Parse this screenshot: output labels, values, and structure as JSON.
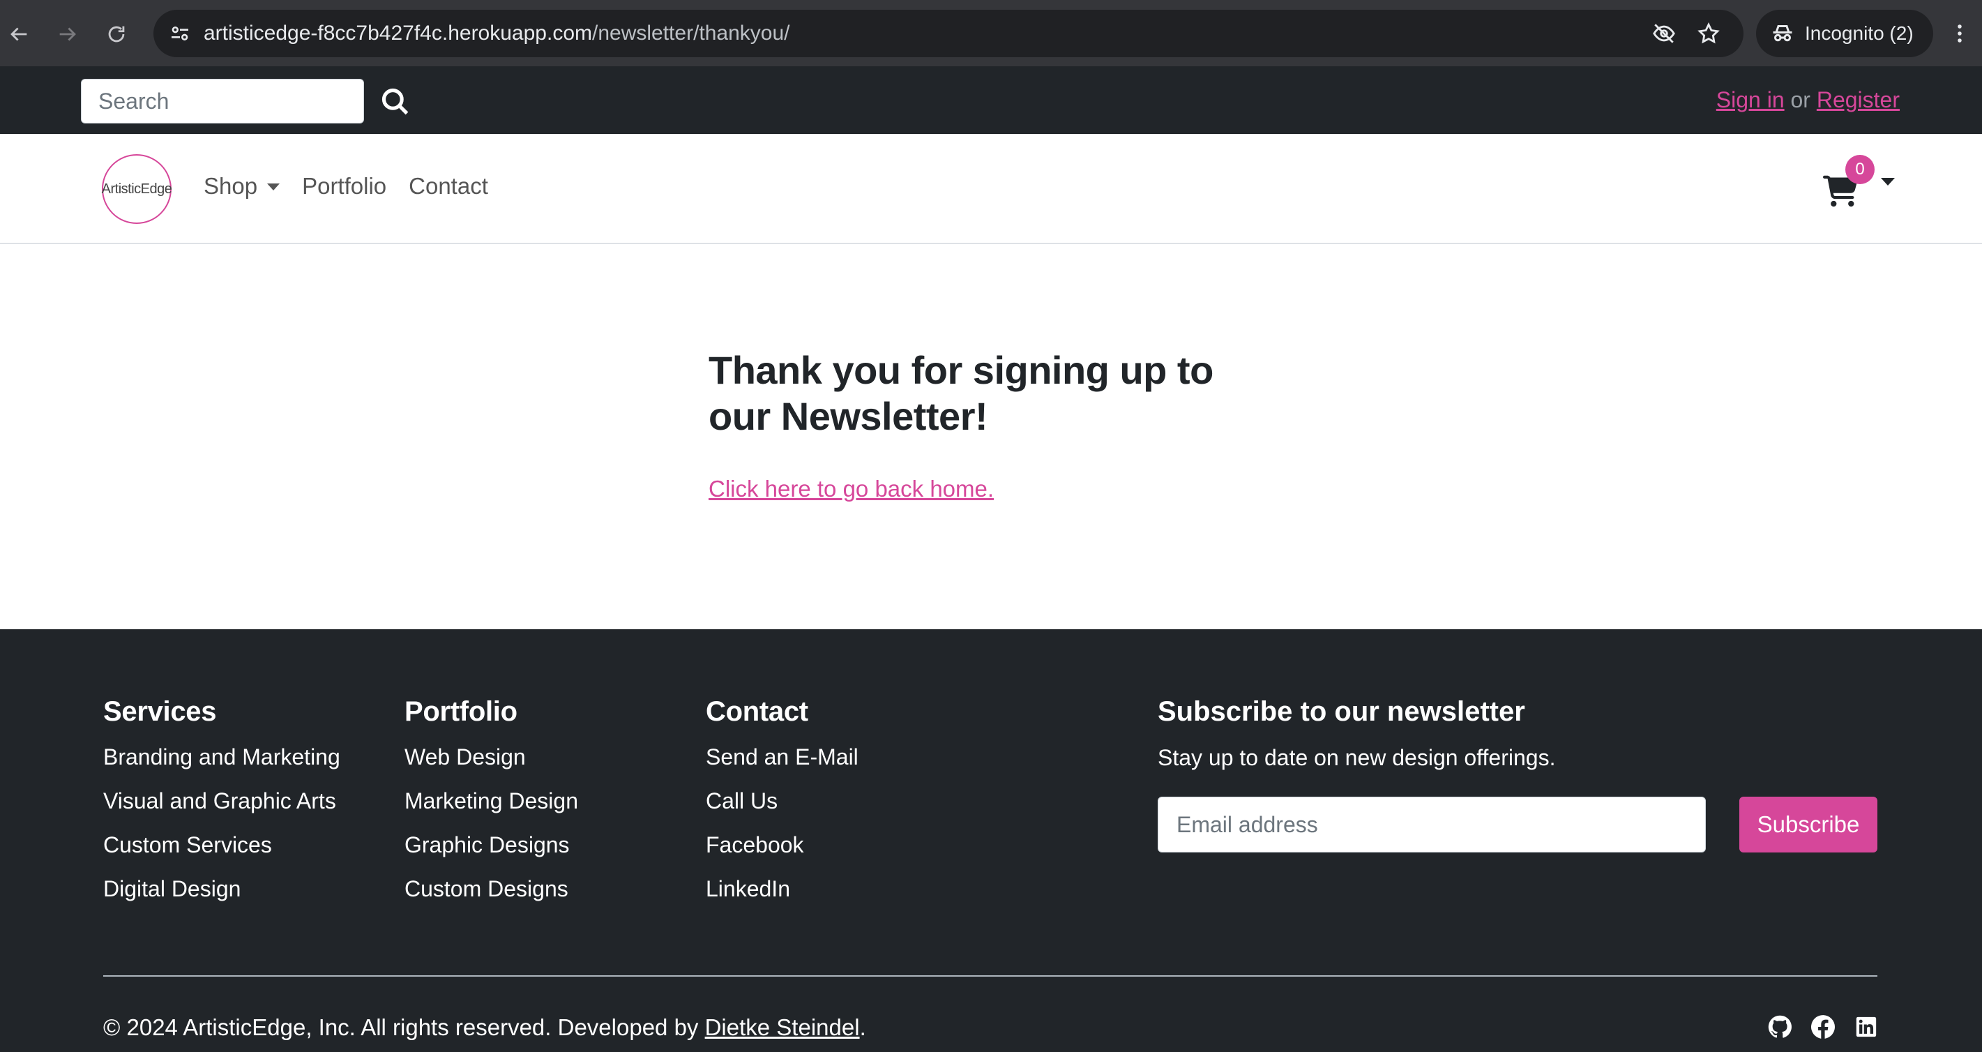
{
  "browser": {
    "url_host": "artisticedge-f8cc7b427f4c.herokuapp.com",
    "url_path": "/newsletter/thankyou/",
    "incognito_label": "Incognito (2)",
    "icons": [
      "back-icon",
      "forward-icon",
      "reload-icon",
      "site-info-icon",
      "eye-off-icon",
      "star-icon",
      "incognito-icon",
      "more-icon"
    ]
  },
  "topbar": {
    "search_placeholder": "Search",
    "sign_in": "Sign in",
    "or": " or ",
    "register": "Register"
  },
  "navbar": {
    "logo_text": "ArtisticEdge",
    "items": [
      {
        "label": "Shop"
      },
      {
        "label": "Portfolio"
      },
      {
        "label": "Contact"
      }
    ],
    "cart_count": "0"
  },
  "main": {
    "heading": "Thank you for signing up to our Newsletter!",
    "home_link": "Click here to go back home."
  },
  "footer": {
    "columns": [
      {
        "title": "Services",
        "links": [
          "Branding and Marketing",
          "Visual and Graphic Arts",
          "Custom Services",
          "Digital Design"
        ]
      },
      {
        "title": "Portfolio",
        "links": [
          "Web Design",
          "Marketing Design",
          "Graphic Designs",
          "Custom Designs"
        ]
      },
      {
        "title": "Contact",
        "links": [
          "Send an E-Mail",
          "Call Us",
          "Facebook",
          "LinkedIn"
        ]
      }
    ],
    "newsletter": {
      "title": "Subscribe to our newsletter",
      "subtitle": "Stay up to date on new design offerings.",
      "email_placeholder": "Email address",
      "button": "Subscribe"
    },
    "copyright_prefix": "© 2024 ArtisticEdge, Inc. All rights reserved. Developed by ",
    "developer": "Dietke Steindel",
    "copyright_suffix": ".",
    "social_icons": [
      "github-icon",
      "facebook-icon",
      "linkedin-icon"
    ]
  },
  "colors": {
    "accent": "#d6479a",
    "dark": "#212529",
    "chrome": "#35363a"
  }
}
